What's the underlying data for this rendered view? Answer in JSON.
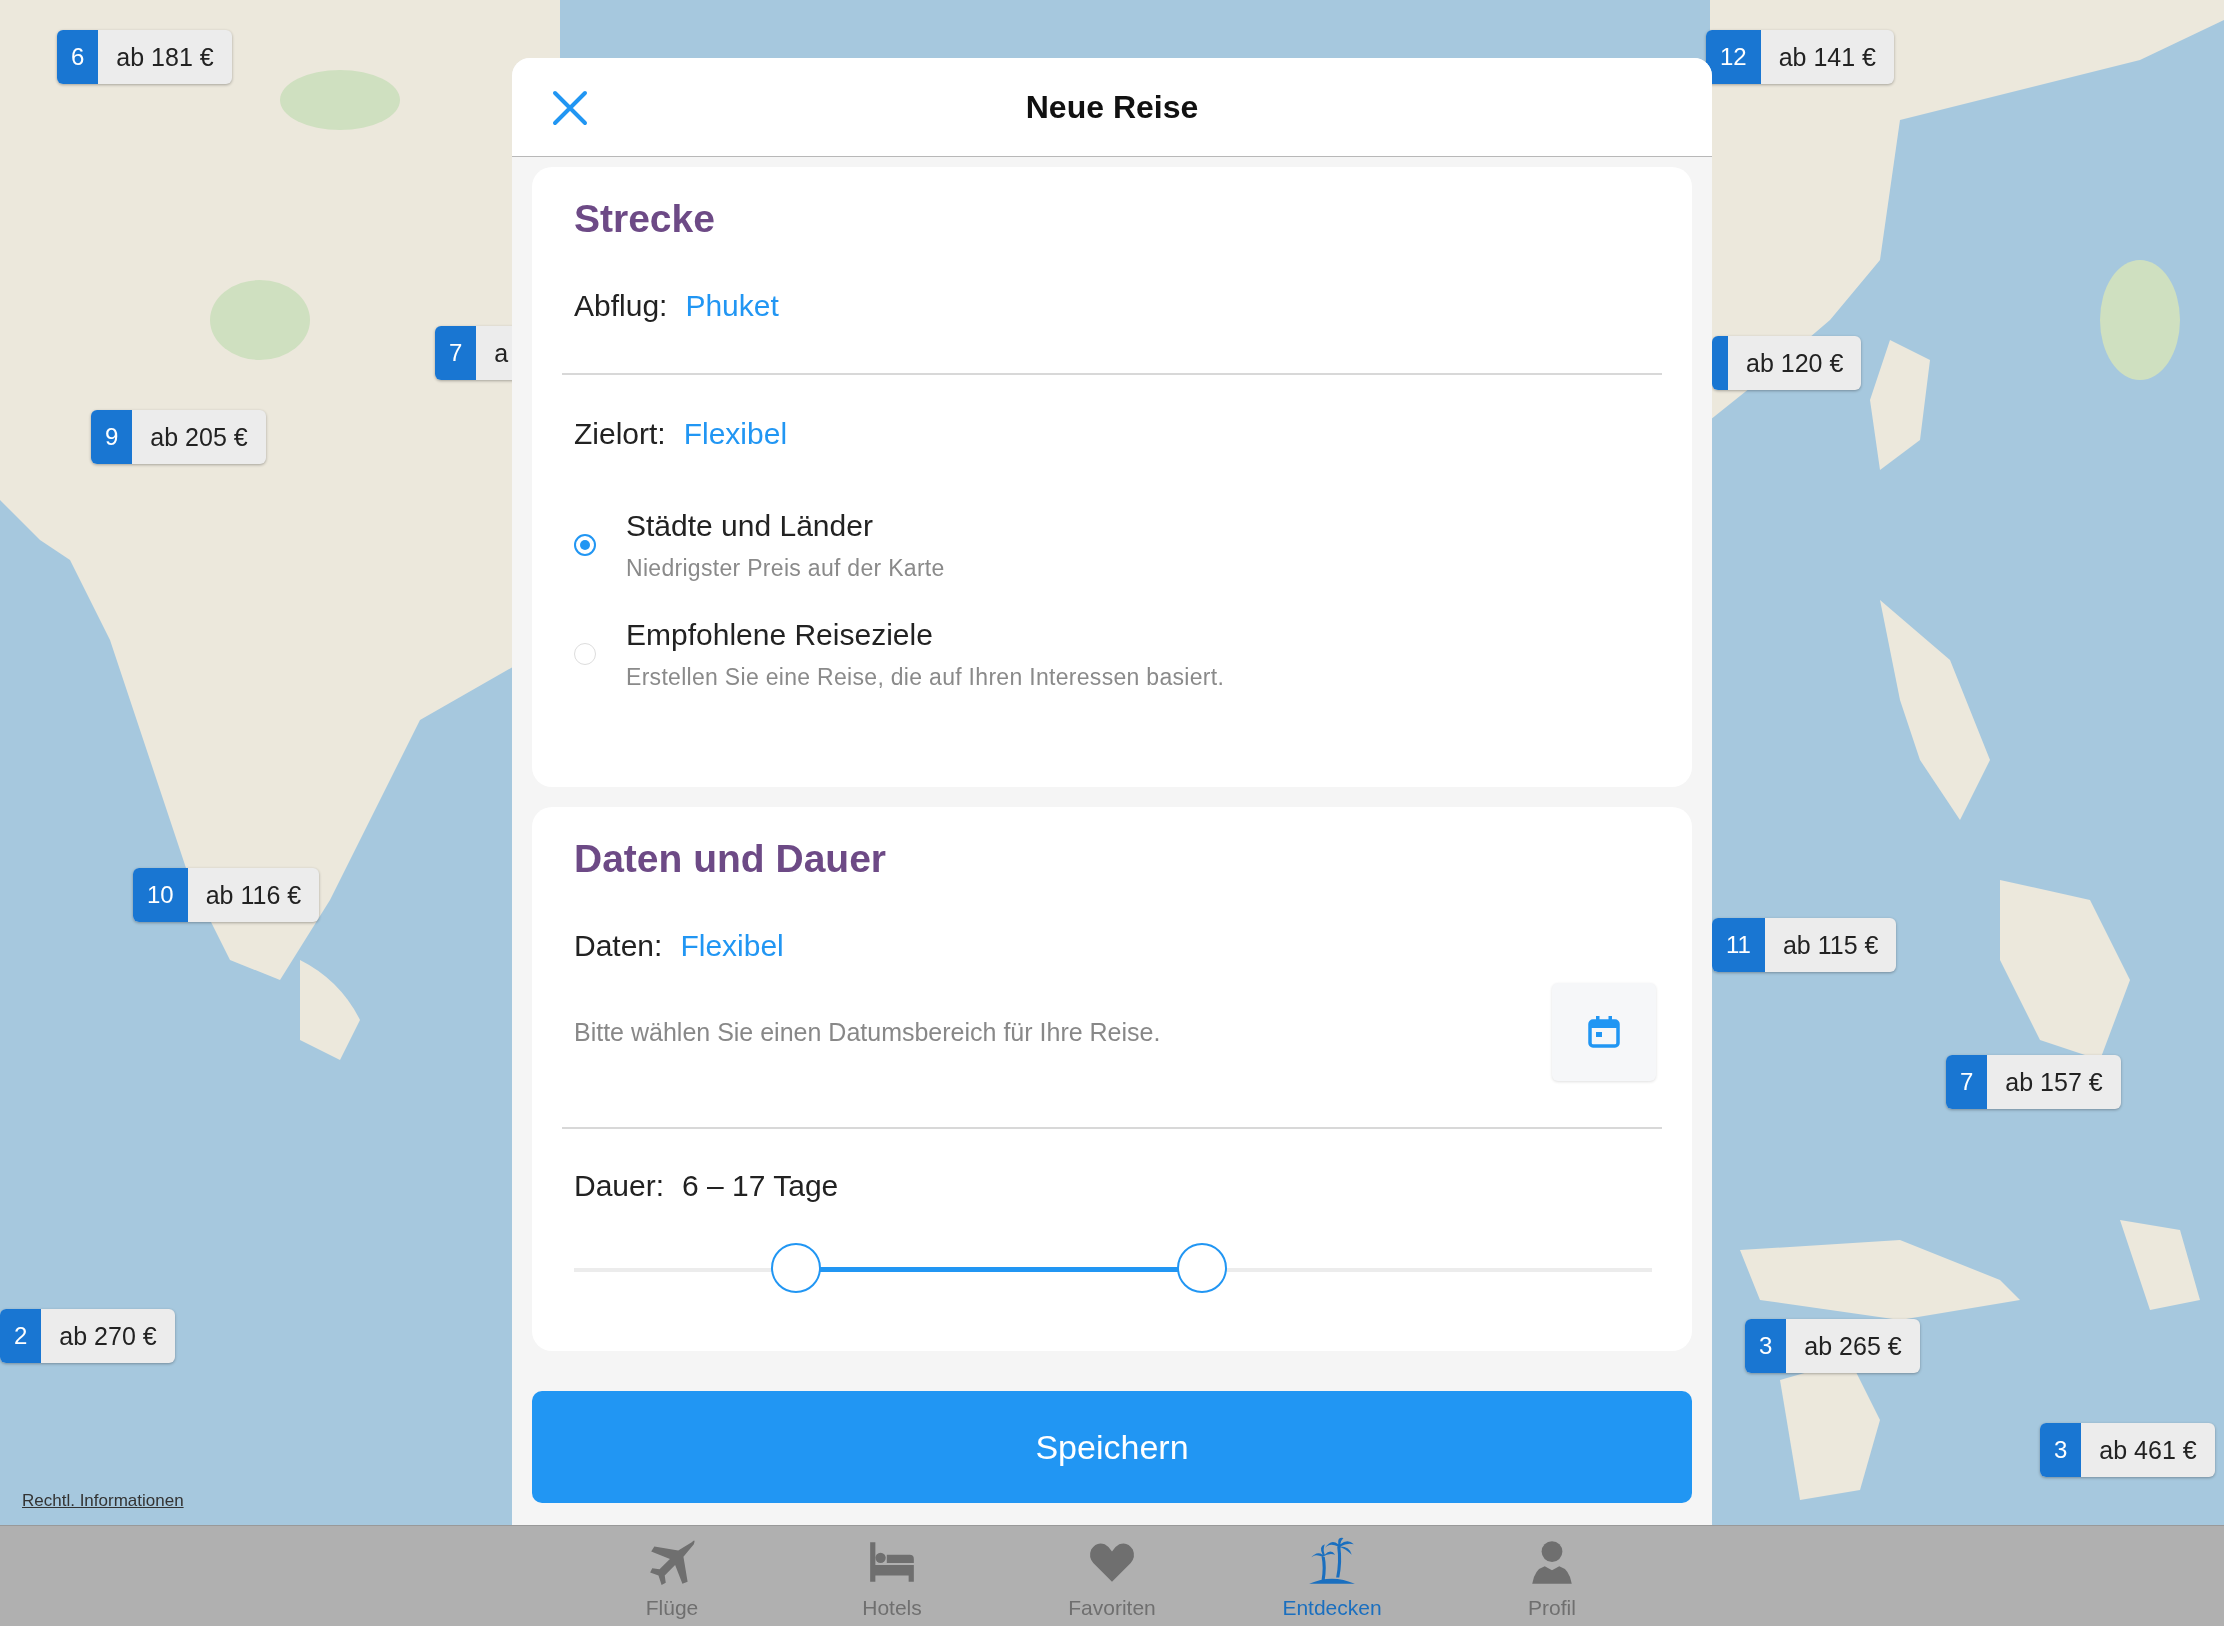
{
  "map": {
    "legal_link": "Rechtl. Informationen",
    "markers": [
      {
        "number": "6",
        "price": "ab 181 €"
      },
      {
        "number": "7",
        "price": "a"
      },
      {
        "number": "9",
        "price": "ab 205 €"
      },
      {
        "number": "10",
        "price": "ab 116 €"
      },
      {
        "number": "2",
        "price": "ab 270 €"
      },
      {
        "number": "12",
        "price": "ab 141 €"
      },
      {
        "price": "ab 120 €"
      },
      {
        "number": "11",
        "price": "ab 115 €"
      },
      {
        "number": "7",
        "price": "ab 157 €"
      },
      {
        "number": "3",
        "price": "ab 265 €"
      },
      {
        "number": "3",
        "price": "ab 461 €"
      }
    ]
  },
  "dialog": {
    "title": "Neue Reise",
    "route": {
      "heading": "Strecke",
      "departure_label": "Abflug:",
      "departure_value": "Phuket",
      "destination_label": "Zielort:",
      "destination_value": "Flexibel",
      "options": [
        {
          "title": "Städte und Länder",
          "subtitle": "Niedrigster Preis auf der Karte",
          "selected": true
        },
        {
          "title": "Empfohlene Reiseziele",
          "subtitle": "Erstellen Sie eine Reise, die auf Ihren Interessen basiert.",
          "selected": false
        }
      ]
    },
    "dates": {
      "heading": "Daten und Dauer",
      "dates_label": "Daten:",
      "dates_value": "Flexibel",
      "date_placeholder": "Bitte wählen Sie einen Datumsbereich für Ihre Reise.",
      "duration_label": "Dauer:",
      "duration_value": "6 – 17 Tage",
      "range": {
        "thumbs": [
          {
            "level": 0.206
          },
          {
            "level": 0.583
          }
        ]
      }
    },
    "save_button": "Speichern"
  },
  "tab_bar": [
    {
      "label": "Flüge",
      "selected": false
    },
    {
      "label": "Hotels",
      "selected": false
    },
    {
      "label": "Favoriten",
      "selected": false
    },
    {
      "label": "Entdecken",
      "selected": true
    },
    {
      "label": "Profil",
      "selected": false
    }
  ]
}
